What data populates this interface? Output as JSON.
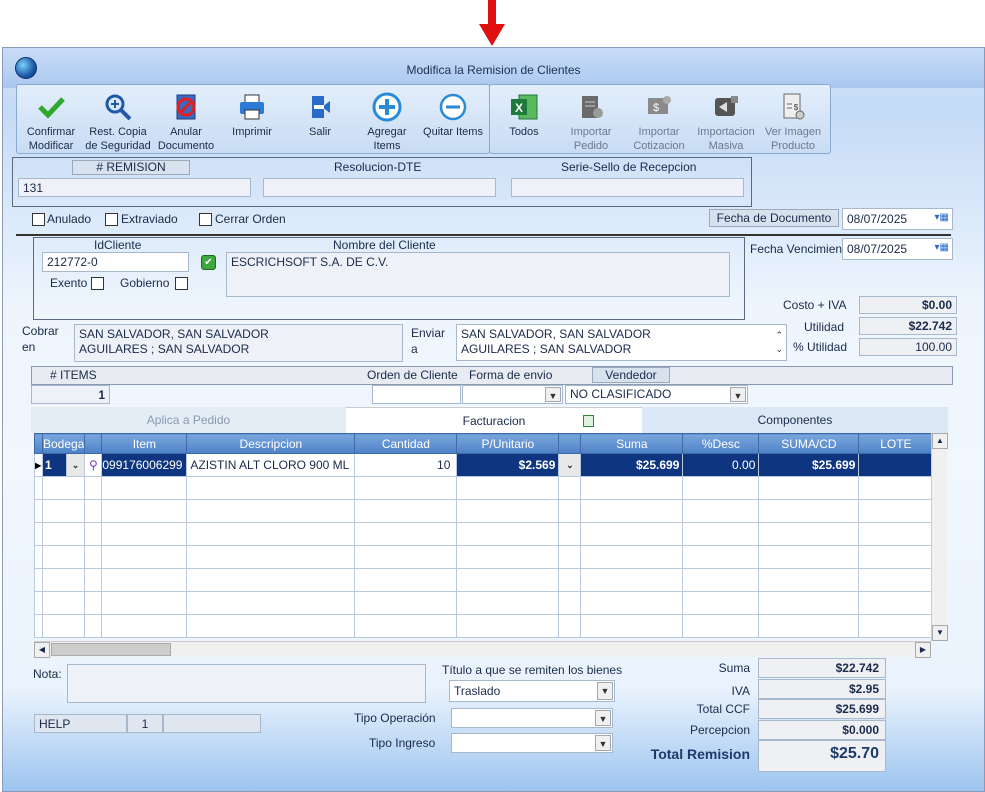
{
  "window": {
    "title": "Modifica la Remision de Clientes"
  },
  "toolbar": {
    "confirm": "Confirmar Modificar",
    "restore": "Rest. Copia de Seguridad",
    "void": "Anular Documento",
    "print": "Imprimir",
    "exit": "Salir",
    "add": "Agregar Items",
    "remove": "Quitar Items",
    "all": "Todos",
    "import_order": "Importar Pedido",
    "import_quote": "Importar Cotizacion",
    "mass_import": "Importacion Masiva",
    "view_image": "Ver Imagen Producto"
  },
  "header": {
    "remision_label": "# REMISION",
    "remision_value": "131",
    "resolucion_label": "Resolucion-DTE",
    "resolucion_value": "",
    "serie_label": "Serie-Sello de Recepcion",
    "serie_value": ""
  },
  "flags": {
    "anulado": "Anulado",
    "extraviado": "Extraviado",
    "cerrar": "Cerrar Orden"
  },
  "dates": {
    "doc_label": "Fecha de  Documento",
    "doc_value": "08/07/2025",
    "venc_label": "Fecha Vencimien",
    "venc_value": "08/07/2025"
  },
  "client": {
    "id_label": "IdCliente",
    "id_value": "212772-0",
    "name_label": "Nombre del Cliente",
    "name_value": "ESCRICHSOFT S.A. DE C.V.",
    "exento": "Exento",
    "gobierno": "Gobierno"
  },
  "costs": {
    "costo_label": "Costo + IVA",
    "costo_value": "$0.00",
    "utilidad_label": "Utilidad",
    "utilidad_value": "$22.742",
    "pct_label": "% Utilidad",
    "pct_value": "100.00"
  },
  "address": {
    "cobrar_label1": "Cobrar",
    "cobrar_label2": "en",
    "cobrar_line1": "SAN SALVADOR, SAN SALVADOR",
    "cobrar_line2": "AGUILARES ; SAN SALVADOR",
    "enviar_label1": "Enviar",
    "enviar_label2": "a",
    "enviar_line1": "SAN SALVADOR, SAN SALVADOR",
    "enviar_line2": "AGUILARES ; SAN SALVADOR"
  },
  "items_bar": {
    "items_label": "# ITEMS",
    "items_value": "1",
    "orden_label": "Orden de Cliente",
    "forma_label": "Forma de envio",
    "vendedor_label": "Vendedor",
    "vendedor_value": "NO CLASIFICADO"
  },
  "tabs": {
    "aplica": "Aplica a Pedido",
    "facturacion": "Facturacion",
    "componentes": "Componentes"
  },
  "grid": {
    "headers": [
      "Bodega",
      "",
      "Item",
      "Descripcion",
      "Cantidad",
      "P/Unitario",
      "",
      "Suma",
      "%Desc",
      "SUMA/CD",
      "LOTE"
    ],
    "row": {
      "bodega": "1",
      "item": "099176006299",
      "descripcion": "AZISTIN ALT CLORO 900 ML",
      "cantidad": "10",
      "punitario": "$2.569",
      "suma": "$25.699",
      "desc": "0.00",
      "sumacd": "$25.699",
      "lote": ""
    }
  },
  "footer": {
    "nota_label": "Nota:",
    "titulo_label": "Título a que se remiten los bienes",
    "titulo_value": "Traslado",
    "tipo_op_label": "Tipo Operación",
    "tipo_ing_label": "Tipo Ingreso",
    "help_label": "HELP",
    "help_num": "1"
  },
  "totals": {
    "suma_label": "Suma",
    "suma_value": "$22.742",
    "iva_label": "IVA",
    "iva_value": "$2.95",
    "ccf_label": "Total CCF",
    "ccf_value": "$25.699",
    "perc_label": "Percepcion",
    "perc_value": "$0.000",
    "total_label": "Total Remision",
    "total_value": "$25.70"
  },
  "colors": {
    "accent": "#0e3680",
    "arrow": "#e01010"
  }
}
